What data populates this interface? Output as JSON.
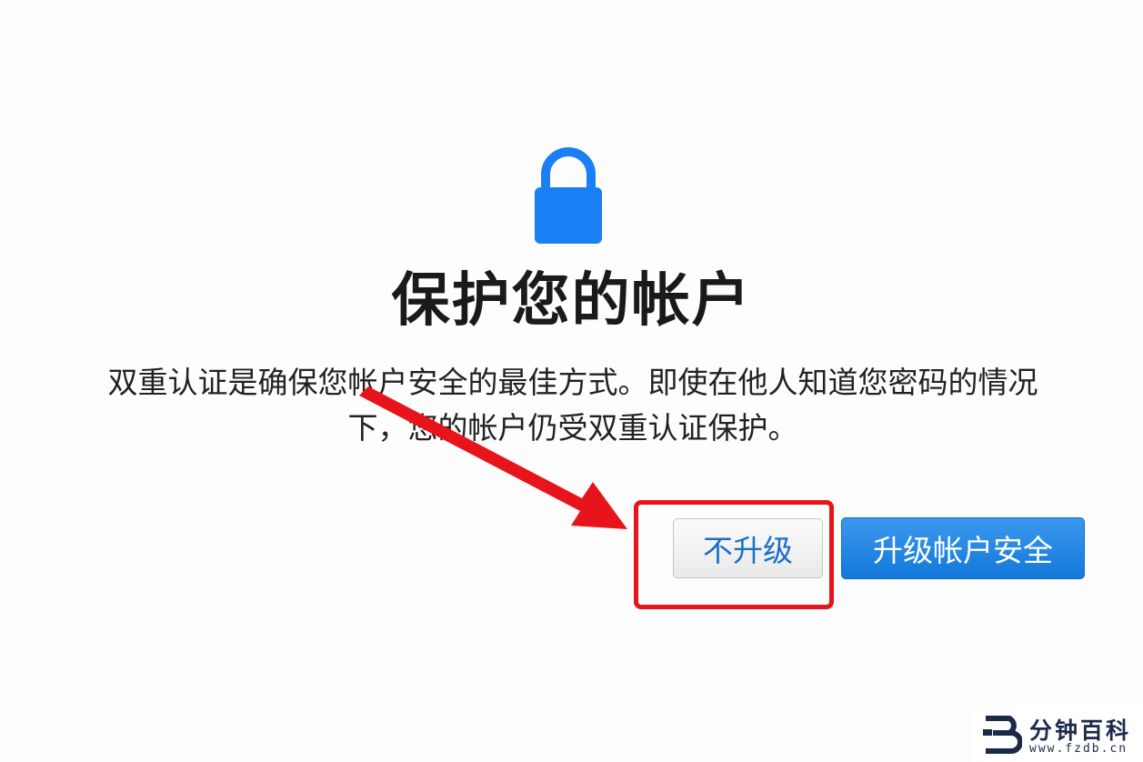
{
  "dialog": {
    "icon": "lock-icon",
    "title": "保护您的帐户",
    "description": "双重认证是确保您帐户安全的最佳方式。即使在他人知道您密码的情况下，您的帐户仍受双重认证保护。",
    "buttons": {
      "skip_label": "不升级",
      "upgrade_label": "升级帐户安全"
    }
  },
  "annotation": {
    "arrow_icon": "red-arrow-icon",
    "highlight_color": "#e8141b"
  },
  "watermark": {
    "title": "分钟百科",
    "url": "www.fzdb.cn"
  },
  "colors": {
    "accent_blue": "#1378da",
    "lock_blue": "#1a7ef5"
  }
}
